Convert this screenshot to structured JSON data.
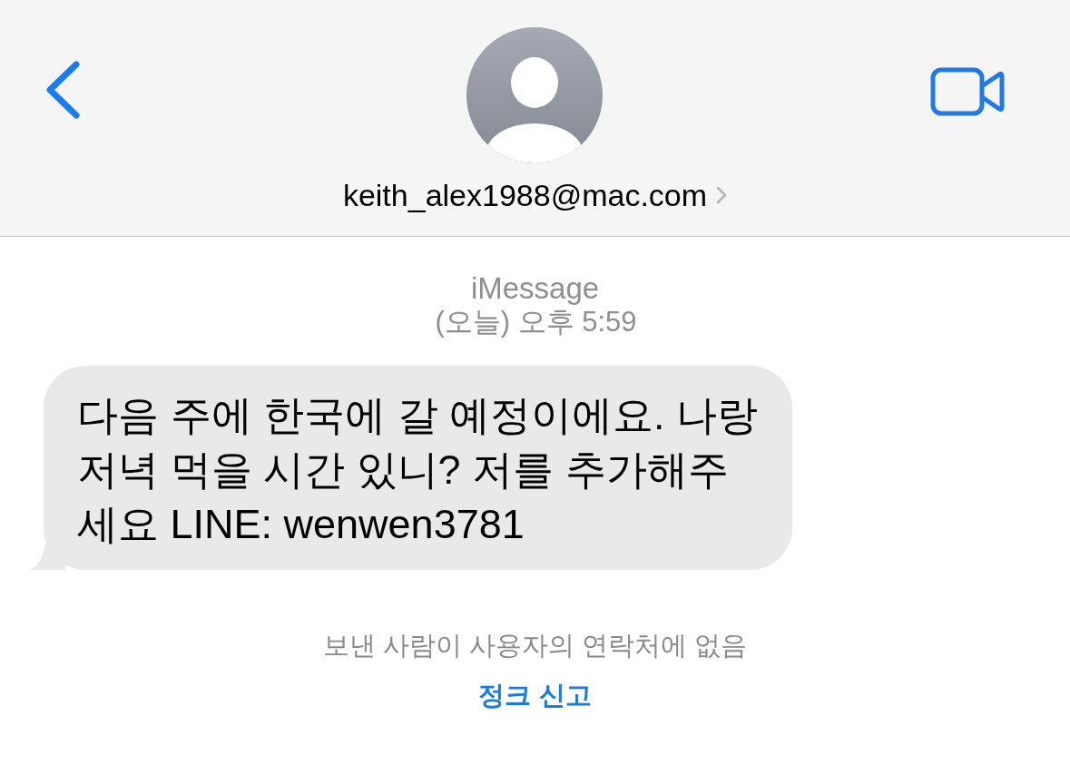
{
  "header": {
    "contact": {
      "address": "keith_alex1988@mac.com"
    }
  },
  "conversation": {
    "service": "iMessage",
    "timestamp": "(오늘) 오후 5:59",
    "messages": [
      {
        "kind": "incoming",
        "text": "다음 주에 한국에 갈 예정이에요. 나랑 저녁 먹을 시간 있니? 저를 추가해주세요 LINE: wenwen3781"
      }
    ]
  },
  "notice": {
    "text": "보낸 사람이 사용자의 연락처에 없음",
    "action": "정크 신고"
  }
}
